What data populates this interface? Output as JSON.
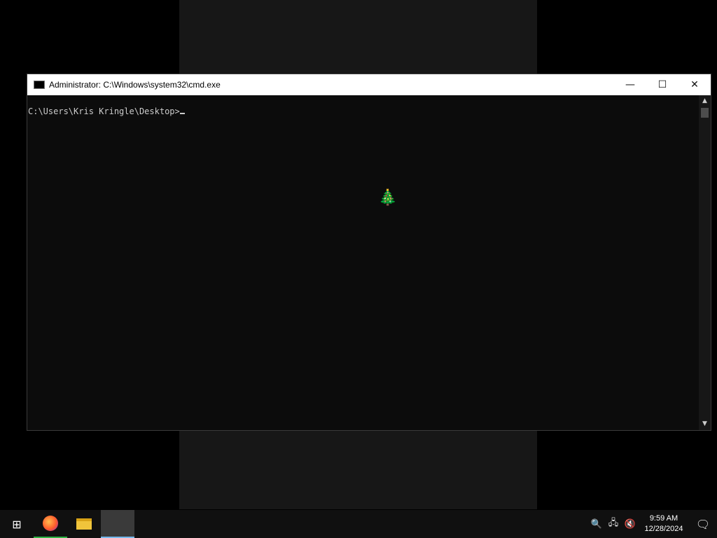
{
  "window": {
    "title": "Administrator: C:\\Windows\\system32\\cmd.exe"
  },
  "console": {
    "prompt": "C:\\Users\\Kris Kringle\\Desktop>"
  },
  "window_buttons": {
    "minimize": "—",
    "maximize": "☐",
    "close": "✕"
  },
  "taskbar": {
    "start_glyph": "⊞"
  },
  "tray": {
    "clock_time": "9:59 AM",
    "clock_date": "12/28/2024"
  },
  "icons": {
    "tree": "🎄",
    "search": "🔍",
    "network": "🖧",
    "volume": "🔇",
    "notifications": "🗨"
  }
}
